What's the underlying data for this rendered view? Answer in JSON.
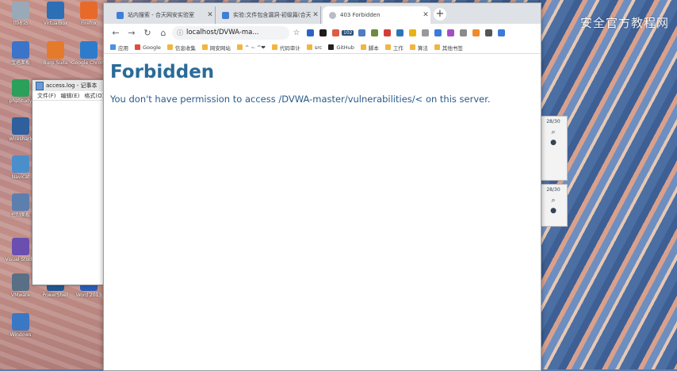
{
  "watermark": "安全官方教程网",
  "desktop": {
    "icons": [
      {
        "label": "回收站",
        "color": "#9aa9b8"
      },
      {
        "label": "VirtualBox",
        "color": "#2d6fb5"
      },
      {
        "label": "Firefox",
        "color": "#e76a2a"
      },
      {
        "label": "宝塔面板",
        "color": "#3c74c9"
      },
      {
        "label": "Burp Suite",
        "color": "#e67a2b"
      },
      {
        "label": "Google Chrome",
        "color": "#2c7ccb"
      },
      {
        "label": "phpStudy",
        "color": "#2aa05a"
      },
      {
        "label": "Wireshark",
        "color": "#2f5f9c"
      },
      {
        "label": "Navicat",
        "color": "#4a8fcc"
      },
      {
        "label": "控制面板",
        "color": "#5c7fae"
      },
      {
        "label": "Visual Studio",
        "color": "#6a4fb0"
      },
      {
        "label": "VMware",
        "color": "#586f86"
      },
      {
        "label": "PowerShell",
        "color": "#21568f"
      },
      {
        "label": "Word 2013",
        "color": "#2b5bb5"
      },
      {
        "label": "Windows",
        "color": "#3b78c3"
      }
    ]
  },
  "notepad": {
    "title": "access.log - 记事本",
    "menu": [
      "文件(F)",
      "编辑(E)",
      "格式(O)"
    ]
  },
  "browser": {
    "tabs": [
      {
        "title": "站内搜索 - 合天网安实验室",
        "active": false,
        "color": "#3f7fd6"
      },
      {
        "title": "实验:文件包含漏洞-初级篇(合天)",
        "active": false,
        "color": "#3f7fd6"
      },
      {
        "title": "403 Forbidden",
        "active": true,
        "color": "#b9bec5"
      }
    ],
    "new_tab": "+",
    "window_controls": [
      "—",
      "☐",
      "✕"
    ],
    "address": "localhost/DVWA-ma...",
    "ext_colors": [
      "#2c64c6",
      "#1c1c1c",
      "#e15a43",
      "#4d7cc1",
      "#6c8a40",
      "#d33f37",
      "#2b75b6",
      "#e7b416",
      "#999999",
      "#3b7ad6",
      "#a34fc2",
      "#8a8a8a",
      "#f08a2a",
      "#555555",
      "#3b7ad6"
    ],
    "ext_badge": "102",
    "bookmarks": [
      {
        "label": "应用",
        "color": "#4d90e7"
      },
      {
        "label": "Google",
        "color": "#e24d3b"
      },
      {
        "label": "信息收集",
        "color": "#f3b540"
      },
      {
        "label": "网安网站",
        "color": "#f3b540"
      },
      {
        "label": "^ ~ ^❤",
        "color": "#f3b540"
      },
      {
        "label": "代码审计",
        "color": "#f3b540"
      },
      {
        "label": "src",
        "color": "#f3b540"
      },
      {
        "label": "GitHub",
        "color": "#222222"
      },
      {
        "label": "脚本",
        "color": "#f3b540"
      },
      {
        "label": "工作",
        "color": "#f3b540"
      },
      {
        "label": "算法",
        "color": "#f3b540"
      },
      {
        "label": "其他书签",
        "color": "#f3b540"
      }
    ],
    "page": {
      "heading": "Forbidden",
      "message": "You don't have permission to access /DVWA-master/vulnerabilities/< on this server."
    }
  },
  "side_panels": [
    {
      "label": "28/30"
    },
    {
      "label": "28/30"
    }
  ]
}
